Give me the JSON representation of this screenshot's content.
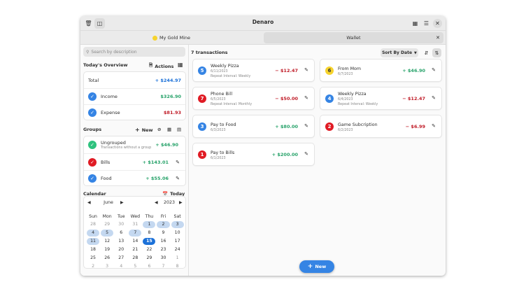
{
  "window": {
    "title": "Denaro"
  },
  "tabs": [
    {
      "label": "My Gold Mine",
      "active": false
    },
    {
      "label": "Wallet",
      "active": true
    }
  ],
  "search": {
    "placeholder": "Search by description"
  },
  "overview": {
    "title": "Today's Overview",
    "actions_label": "Actions",
    "total": {
      "label": "Total",
      "value": "+ $244.97"
    },
    "income": {
      "label": "Income",
      "value": "$326.90"
    },
    "expense": {
      "label": "Expense",
      "value": "$81.93"
    }
  },
  "groups": {
    "title": "Groups",
    "new_label": "New",
    "items": [
      {
        "name": "Ungrouped",
        "desc": "Transactions without a group",
        "amount": "+ $46.90",
        "color": "#2ec27e"
      },
      {
        "name": "Bills",
        "desc": "",
        "amount": "+ $143.01",
        "color": "#e01b24"
      },
      {
        "name": "Food",
        "desc": "",
        "amount": "+ $55.06",
        "color": "#3584e4"
      }
    ]
  },
  "calendar": {
    "title": "Calendar",
    "today_label": "Today",
    "month": "June",
    "year": "2023",
    "weekdays": [
      "Sun",
      "Mon",
      "Tue",
      "Wed",
      "Thu",
      "Fri",
      "Sat"
    ],
    "days": [
      [
        "28",
        "29",
        "30",
        "31",
        "1",
        "2",
        "3"
      ],
      [
        "4",
        "5",
        "6",
        "7",
        "8",
        "9",
        "10"
      ],
      [
        "11",
        "12",
        "13",
        "14",
        "15",
        "16",
        "17"
      ],
      [
        "18",
        "19",
        "20",
        "21",
        "22",
        "23",
        "24"
      ],
      [
        "25",
        "26",
        "27",
        "28",
        "29",
        "30",
        "1"
      ],
      [
        "2",
        "3",
        "4",
        "5",
        "6",
        "7",
        "8"
      ]
    ]
  },
  "main": {
    "count_label": "7 transactions",
    "sort_label": "Sort By Date",
    "new_button": "New",
    "transactions": [
      {
        "id": "5",
        "name": "Weekly Pizza",
        "date": "6/11/2023",
        "repeat": "Repeat Interval: Weekly",
        "amount": "− $12.47",
        "type": "expense",
        "color": "#3584e4"
      },
      {
        "id": "6",
        "name": "From Mom",
        "date": "6/7/2023",
        "repeat": "",
        "amount": "+ $46.90",
        "type": "income",
        "color": "#f6d32d"
      },
      {
        "id": "7",
        "name": "Phone Bill",
        "date": "6/5/2023",
        "repeat": "Repeat Interval: Monthly",
        "amount": "− $50.00",
        "type": "expense",
        "color": "#e01b24"
      },
      {
        "id": "4",
        "name": "Weekly Pizza",
        "date": "6/4/2023",
        "repeat": "Repeat Interval: Weekly",
        "amount": "− $12.47",
        "type": "expense",
        "color": "#3584e4"
      },
      {
        "id": "3",
        "name": "Pay to Food",
        "date": "6/3/2023",
        "repeat": "",
        "amount": "+ $80.00",
        "type": "income",
        "color": "#3584e4"
      },
      {
        "id": "2",
        "name": "Game Subcription",
        "date": "6/2/2023",
        "repeat": "",
        "amount": "− $6.99",
        "type": "expense",
        "color": "#e01b24"
      },
      {
        "id": "1",
        "name": "Pay to Bills",
        "date": "6/1/2023",
        "repeat": "",
        "amount": "+ $200.00",
        "type": "income",
        "color": "#e01b24"
      }
    ]
  }
}
